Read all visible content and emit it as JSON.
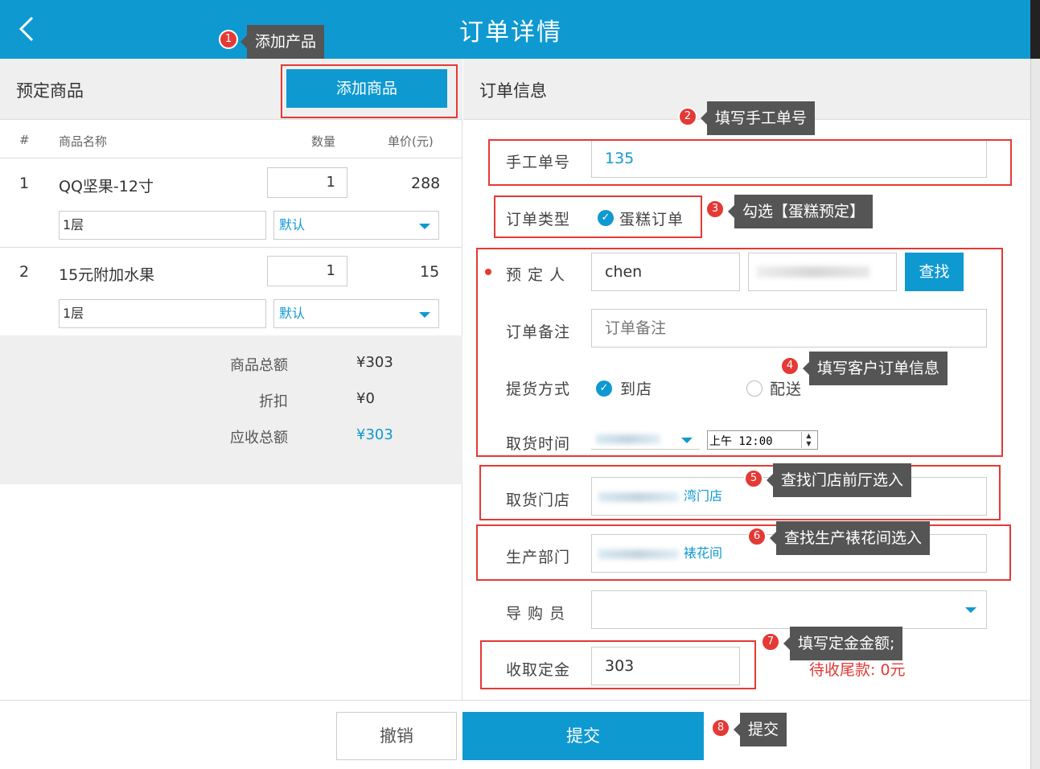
{
  "header": {
    "title": "订单详情",
    "back_icon": "chevron-left-icon"
  },
  "left": {
    "title": "预定商品",
    "add_button": "添加商品",
    "columns": {
      "index": "#",
      "name": "商品名称",
      "qty": "数量",
      "price": "单价(元)"
    },
    "items": [
      {
        "index": "1",
        "name": "QQ坚果-12寸",
        "qty": "1",
        "price": "288",
        "layer": "1层",
        "option": "默认"
      },
      {
        "index": "2",
        "name": "15元附加水果",
        "qty": "1",
        "price": "15",
        "layer": "1层",
        "option": "默认"
      }
    ],
    "summary": [
      {
        "label": "商品总额",
        "value": "¥303"
      },
      {
        "label": "折扣",
        "value": "¥0"
      },
      {
        "label": "应收总额",
        "value": "¥303"
      }
    ]
  },
  "right": {
    "title": "订单信息",
    "manual_no": {
      "label": "手工单号",
      "value": "135"
    },
    "order_type": {
      "label": "订单类型",
      "option": "蛋糕订单"
    },
    "orderer": {
      "label": "预 定 人",
      "value": "chen",
      "search_button": "查找"
    },
    "remark": {
      "label": "订单备注",
      "placeholder": "订单备注"
    },
    "delivery": {
      "label": "提货方式",
      "option_store": "到店",
      "option_ship": "配送"
    },
    "pickup_time": {
      "label": "取货时间",
      "time": "上午 12:00"
    },
    "pickup_store": {
      "label": "取货门店",
      "value": "湾门店"
    },
    "production_dept": {
      "label": "生产部门",
      "value": "裱花间"
    },
    "guide": {
      "label": "导 购 员"
    },
    "deposit": {
      "label": "收取定金",
      "value": "303"
    },
    "balance_text": "待收尾款: 0元"
  },
  "footer": {
    "cancel": "撤销",
    "submit": "提交"
  },
  "annotations": [
    {
      "num": "1",
      "text": "添加产品"
    },
    {
      "num": "2",
      "text": "填写手工单号"
    },
    {
      "num": "3",
      "text": "勾选【蛋糕预定】"
    },
    {
      "num": "4",
      "text": "填写客户订单信息"
    },
    {
      "num": "5",
      "text": "查找门店前厅选入"
    },
    {
      "num": "6",
      "text": "查找生产裱花间选入"
    },
    {
      "num": "7",
      "text": "填写定金金额;"
    },
    {
      "num": "8",
      "text": "提交"
    }
  ],
  "colors": {
    "primary": "#0f99d1",
    "annotation_red": "#e53935",
    "tooltip_gray": "#555555"
  }
}
